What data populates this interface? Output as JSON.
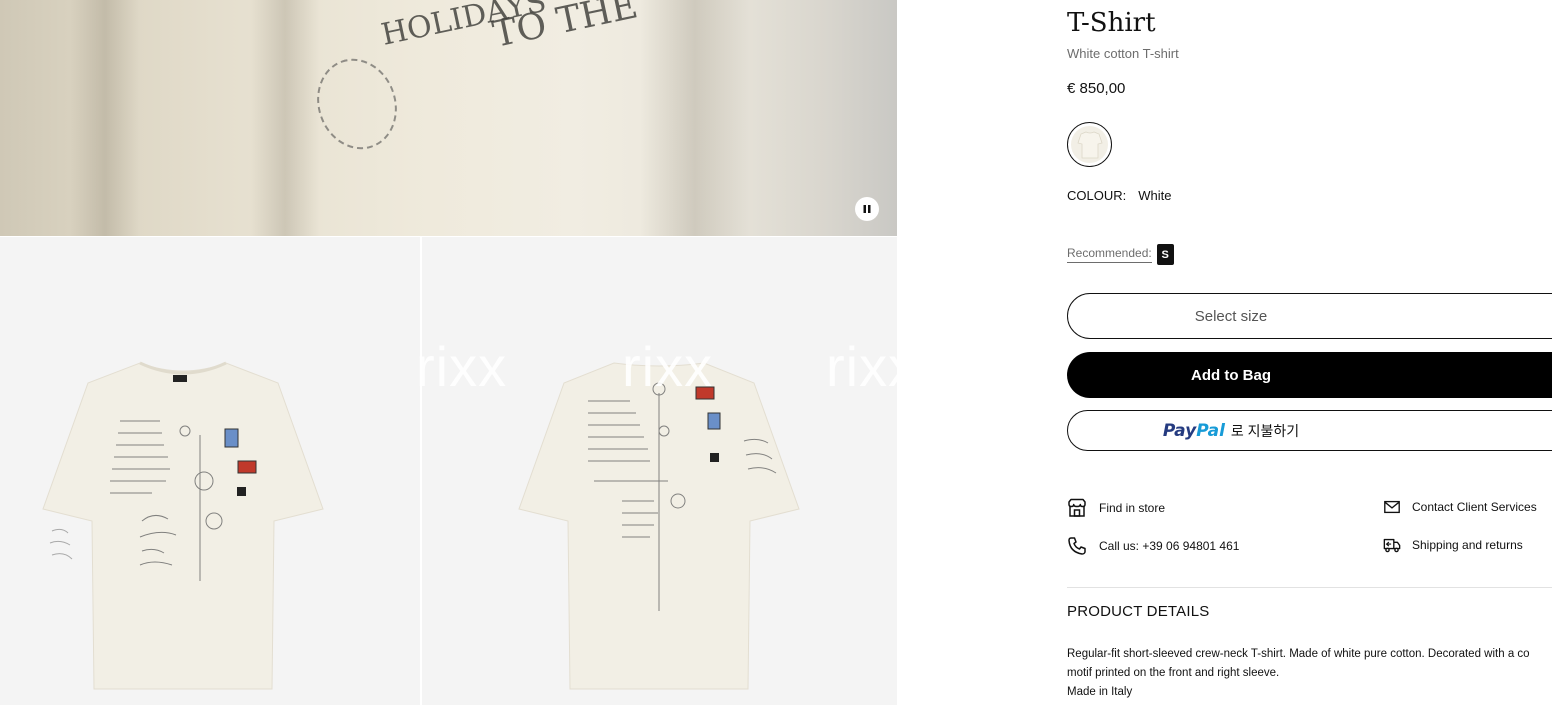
{
  "gallery": {
    "video_scribbles": [
      "HOLIDAYS'",
      "TO THE"
    ],
    "pause_icon": "pause-icon",
    "watermark": "rixx"
  },
  "product": {
    "title": "T-Shirt",
    "subtitle": "White cotton T-shirt",
    "price": "€ 850,00",
    "colour_label": "COLOUR:",
    "colour_value": "White",
    "recommended_label": "Recommended:",
    "recommended_size": "S"
  },
  "actions": {
    "select_size": "Select size",
    "add_to_bag": "Add to Bag",
    "paypal_pay": "Pay",
    "paypal_pal": "Pal",
    "paypal_text": "로 지불하기"
  },
  "services": {
    "find_in_store": "Find in store",
    "call_us": "Call us: +39 06 94801 461",
    "contact": "Contact Client Services",
    "shipping": "Shipping and returns"
  },
  "details": {
    "title": "PRODUCT DETAILS",
    "line1": "Regular-fit short-sleeved crew-neck T-shirt. Made of white pure cotton. Decorated with a co",
    "line2": "motif printed on the front and right sleeve.",
    "line3": "Made in Italy"
  },
  "colors": {
    "primary_button": "#000000",
    "garment": "#f2efe6",
    "tile_background": "#f4f4f4",
    "paypal_dark": "#253b80",
    "paypal_light": "#179bd7"
  }
}
